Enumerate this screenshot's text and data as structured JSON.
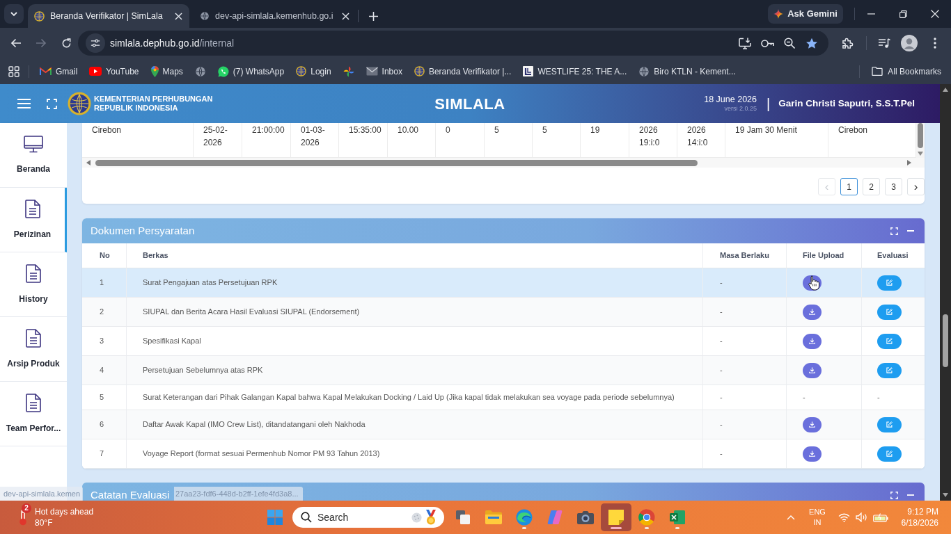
{
  "browser": {
    "tabs": [
      {
        "title": "Beranda Verifikator | SimLala",
        "selected": true
      },
      {
        "title": "dev-api-simlala.kemenhub.go.i",
        "selected": false
      }
    ],
    "assistant_button": "Ask Gemini",
    "address": {
      "host": "simlala.dephub.go.id",
      "path": "/internal",
      "bookmarked": true
    },
    "bookmarks": [
      {
        "kind": "link",
        "label": "Gmail"
      },
      {
        "kind": "link",
        "label": "YouTube"
      },
      {
        "kind": "link",
        "label": "Maps"
      },
      {
        "kind": "icon"
      },
      {
        "kind": "link",
        "label": "(7) WhatsApp"
      },
      {
        "kind": "link",
        "label": "Login"
      },
      {
        "kind": "icon"
      },
      {
        "kind": "link",
        "label": "Inbox"
      },
      {
        "kind": "link",
        "label": "Beranda Verifikator |..."
      },
      {
        "kind": "link",
        "label": "WESTLIFE 25: THE A..."
      },
      {
        "kind": "link",
        "label": "Biro KTLN - Kement..."
      }
    ],
    "all_bookmarks": "All Bookmarks",
    "status_link": {
      "start": "dev-api-simlala.kemen",
      "end": "27aa23-fdf6-448d-b2ff-1efe4fd3a8..."
    }
  },
  "header": {
    "org_name": "KEMENTERIAN PERHUBUNGAN\nREPUBLIK INDONESIA",
    "app_title": "SIMLALA",
    "date": "18 June 2026",
    "version": "versi 2.0.25",
    "divider": "|",
    "user": "Garin Christi Saputri, S.S.T.Pel"
  },
  "sidebar": {
    "items": [
      {
        "label": "Beranda",
        "selected": false
      },
      {
        "label": "Perizinan",
        "selected": true
      },
      {
        "label": "History",
        "selected": false
      },
      {
        "label": "Arsip Produk",
        "selected": false
      },
      {
        "label": "Team Perfor...",
        "selected": false
      }
    ]
  },
  "voyage_table": {
    "row": [
      "Cirebon",
      "25-02-\n2026",
      "21:00:00",
      "01-03-\n2026",
      "15:35:00",
      "10.00",
      "0",
      "5",
      "5",
      "19",
      "2026\n19:i:0",
      "2026\n14:i:0",
      "19 Jam 30 Menit",
      "Cirebon"
    ],
    "pagination": {
      "prev": "‹",
      "prev_disabled": true,
      "pages": [
        {
          "label": "1",
          "selected": true
        },
        {
          "label": "2",
          "selected": false
        },
        {
          "label": "3",
          "selected": false
        }
      ],
      "next": "›"
    }
  },
  "documents": {
    "title": "Dokumen Persyaratan",
    "columns": [
      "No",
      "Berkas",
      "Masa Berlaku",
      "File Upload",
      "Evaluasi"
    ],
    "rows": [
      {
        "no": "1",
        "berkas": "Surat Pengajuan atas Persetujuan RPK",
        "masa_berlaku": "-",
        "kind": "actions",
        "hovered": true
      },
      {
        "no": "2",
        "berkas": "SIUPAL dan Berita Acara Hasil Evaluasi SIUPAL (Endorsement)",
        "masa_berlaku": "-",
        "kind": "actions",
        "hovered": false
      },
      {
        "no": "3",
        "berkas": "Spesifikasi Kapal",
        "masa_berlaku": "-",
        "kind": "actions",
        "hovered": false
      },
      {
        "no": "4",
        "berkas": "Persetujuan Sebelumnya atas RPK",
        "masa_berlaku": "-",
        "kind": "actions",
        "hovered": false
      },
      {
        "no": "5",
        "berkas": "Surat Keterangan dari Pihak Galangan Kapal bahwa Kapal Melakukan Docking / Laid Up (Jika kapal tidak melakukan sea voyage pada periode sebelumnya)",
        "masa_berlaku": "-",
        "kind": "text",
        "file_upload": "-",
        "evaluasi": "-",
        "hovered": false
      },
      {
        "no": "6",
        "berkas": "Daftar Awak Kapal (IMO Crew List), ditandatangani oleh Nakhoda",
        "masa_berlaku": "-",
        "kind": "actions",
        "hovered": false
      },
      {
        "no": "7",
        "berkas": "Voyage Report (format sesuai Permenhub Nomor PM 93 Tahun 2013)",
        "masa_berlaku": "-",
        "kind": "actions",
        "hovered": false
      }
    ]
  },
  "notes_panel": {
    "title": "Catatan Evaluasi"
  },
  "taskbar": {
    "weather": {
      "badge": "2",
      "headline": "Hot days ahead",
      "temperature": "80°F"
    },
    "search": {
      "placeholder": "Search"
    },
    "apps": [
      {
        "running": false,
        "active": false
      },
      {
        "running": false,
        "active": false
      },
      {
        "running": true,
        "active": false
      },
      {
        "running": false,
        "active": false
      },
      {
        "running": false,
        "active": false
      },
      {
        "running": true,
        "active": true
      },
      {
        "running": true,
        "active": false
      },
      {
        "running": true,
        "active": false
      }
    ],
    "language": "ENG",
    "region": "IN",
    "time": "9:12 PM",
    "date": "6/18/2026"
  }
}
